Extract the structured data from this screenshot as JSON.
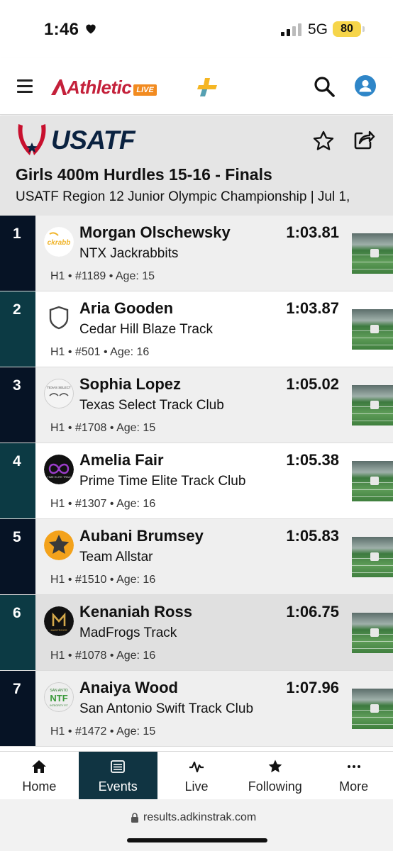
{
  "status_bar": {
    "time": "1:46",
    "network": "5G",
    "battery": "80"
  },
  "header": {
    "logo_text": "Athletic",
    "logo_badge": "LIVE"
  },
  "event": {
    "org_logo_text": "USATF",
    "title": "Girls 400m Hurdles 15-16 - Finals",
    "subtitle": "USATF Region 12 Junior Olympic Championship | Jul 1,"
  },
  "results": [
    {
      "place": "1",
      "name": "Morgan Olschewsky",
      "team": "NTX Jackrabbits",
      "heat": "H1",
      "bib": "#1189",
      "age": "Age: 15",
      "mark": "1:03.81",
      "place_color": "#061325",
      "row_bg": "#efefef"
    },
    {
      "place": "2",
      "name": "Aria Gooden",
      "team": "Cedar Hill Blaze Track",
      "heat": "H1",
      "bib": "#501",
      "age": "Age: 16",
      "mark": "1:03.87",
      "place_color": "#0c3a44",
      "row_bg": "#ffffff"
    },
    {
      "place": "3",
      "name": "Sophia Lopez",
      "team": "Texas Select Track Club",
      "heat": "H1",
      "bib": "#1708",
      "age": "Age: 15",
      "mark": "1:05.02",
      "place_color": "#061325",
      "row_bg": "#efefef"
    },
    {
      "place": "4",
      "name": "Amelia Fair",
      "team": "Prime Time Elite Track Club",
      "heat": "H1",
      "bib": "#1307",
      "age": "Age: 16",
      "mark": "1:05.38",
      "place_color": "#0c3a44",
      "row_bg": "#ffffff"
    },
    {
      "place": "5",
      "name": "Aubani Brumsey",
      "team": "Team Allstar",
      "heat": "H1",
      "bib": "#1510",
      "age": "Age: 16",
      "mark": "1:05.83",
      "place_color": "#061325",
      "row_bg": "#efefef"
    },
    {
      "place": "6",
      "name": "Kenaniah Ross",
      "team": "MadFrogs Track",
      "heat": "H1",
      "bib": "#1078",
      "age": "Age: 16",
      "mark": "1:06.75",
      "place_color": "#0c3a44",
      "row_bg": "#e0e0e0"
    },
    {
      "place": "7",
      "name": "Anaiya Wood",
      "team": "San Antonio Swift Track Club",
      "heat": "H1",
      "bib": "#1472",
      "age": "Age: 15",
      "mark": "1:07.96",
      "place_color": "#061325",
      "row_bg": "#efefef"
    }
  ],
  "tabs": [
    {
      "label": "Home",
      "icon": "home-icon",
      "active": false
    },
    {
      "label": "Events",
      "icon": "list-icon",
      "active": true
    },
    {
      "label": "Live",
      "icon": "pulse-icon",
      "active": false
    },
    {
      "label": "Following",
      "icon": "star-icon",
      "active": false
    },
    {
      "label": "More",
      "icon": "more-dots-icon",
      "active": false
    }
  ],
  "browser": {
    "url": "results.adkinstrak.com"
  },
  "colors": {
    "active_tab": "#103442",
    "brand_red": "#c4203a",
    "brand_orange": "#f28b20",
    "usatf_navy": "#0a2240"
  }
}
